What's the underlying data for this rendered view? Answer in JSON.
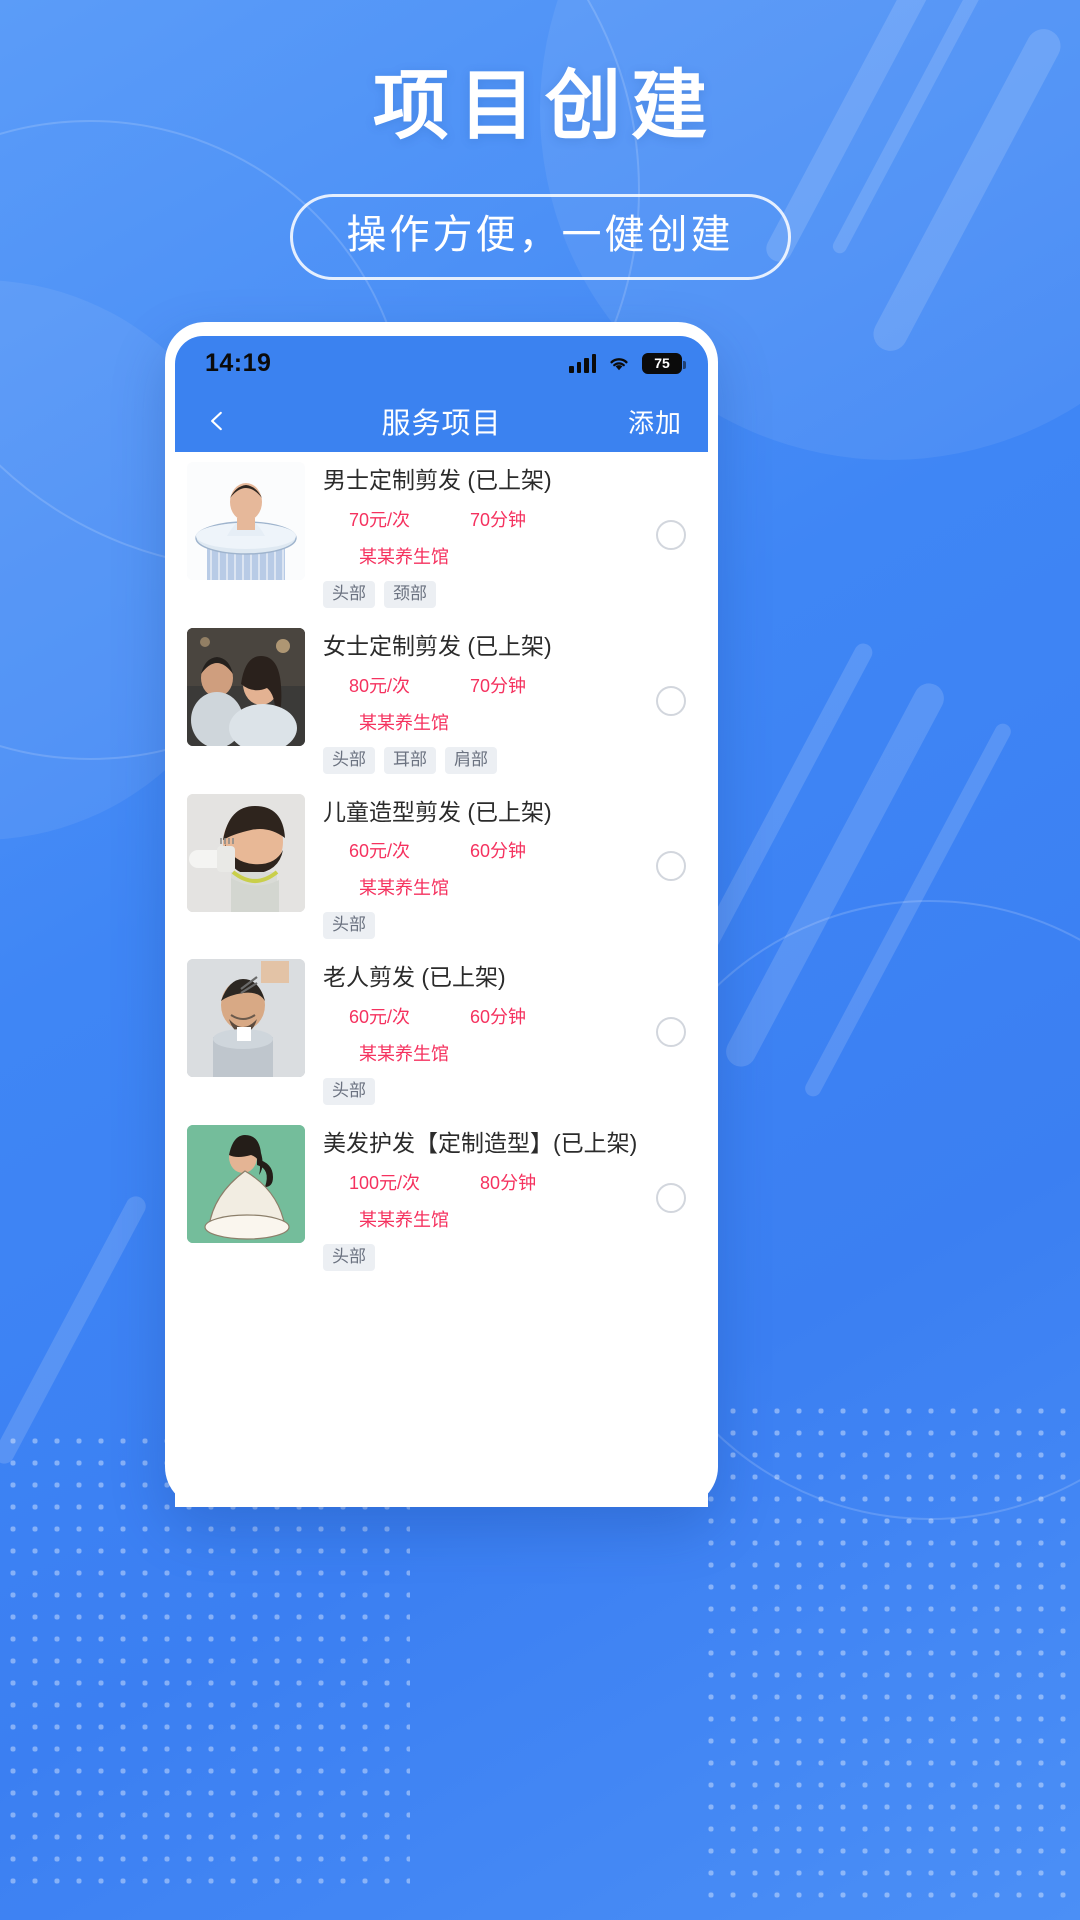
{
  "hero": {
    "title": "项目创建",
    "subtitle": "操作方便，一健创建"
  },
  "colors": {
    "brand_blue": "#3b82f0",
    "page_blue": "#4a8cf6",
    "accent_red": "#f5325f",
    "tag_bg": "#eceff3",
    "tag_text": "#6b7280"
  },
  "phone": {
    "status_bar": {
      "time": "14:19",
      "signal_icon": "signal-bars-icon",
      "wifi_icon": "wifi-icon",
      "battery_level": "75",
      "battery_icon": "battery-icon"
    },
    "nav_bar": {
      "back_icon": "chevron-left-icon",
      "title": "服务项目",
      "action_label": "添加"
    },
    "list": {
      "items": [
        {
          "title": "男士定制剪发 (已上架)",
          "price": "70元/次",
          "duration": "70分钟",
          "shop": "某某养生馆",
          "tags": [
            "头部",
            "颈部"
          ],
          "selected": false,
          "thumb_name": "service-photo-mens-haircut"
        },
        {
          "title": "女士定制剪发 (已上架)",
          "price": "80元/次",
          "duration": "70分钟",
          "shop": "某某养生馆",
          "tags": [
            "头部",
            "耳部",
            "肩部"
          ],
          "selected": false,
          "thumb_name": "service-photo-womens-haircut"
        },
        {
          "title": "儿童造型剪发 (已上架)",
          "price": "60元/次",
          "duration": "60分钟",
          "shop": "某某养生馆",
          "tags": [
            "头部"
          ],
          "selected": false,
          "thumb_name": "service-photo-kids-haircut"
        },
        {
          "title": "老人剪发 (已上架)",
          "price": "60元/次",
          "duration": "60分钟",
          "shop": "某某养生馆",
          "tags": [
            "头部"
          ],
          "selected": false,
          "thumb_name": "service-photo-senior-haircut"
        },
        {
          "title": "美发护发【定制造型】(已上架)",
          "price": "100元/次",
          "duration": "80分钟",
          "shop": "某某养生馆",
          "tags": [
            "头部"
          ],
          "selected": false,
          "thumb_name": "service-photo-hair-care"
        }
      ]
    }
  }
}
